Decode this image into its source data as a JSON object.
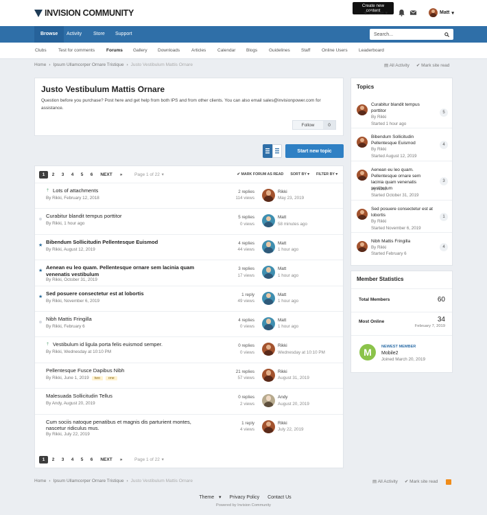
{
  "header": {
    "logo": "INVISION COMMUNITY",
    "tooltip": "Create new content",
    "create_label": "Create",
    "user_name": "Matt"
  },
  "nav": {
    "items": [
      "Browse",
      "Activity",
      "Store",
      "Support"
    ],
    "active": "Browse",
    "search_placeholder": "Search..."
  },
  "subnav": {
    "items": [
      "Clubs",
      "Test for comments",
      "Forums",
      "Gallery",
      "Downloads",
      "Articles",
      "Calendar",
      "Blogs",
      "Guidelines",
      "Staff",
      "Online Users",
      "Leaderboard"
    ],
    "active": "Forums"
  },
  "breadcrumb": {
    "items": [
      "Home",
      "Ipsum Ullamcorper Ornare Tristique",
      "Justo Vestibulum Mattis Ornare"
    ],
    "all_activity": "All Activity",
    "mark_read": "Mark site read"
  },
  "forum": {
    "title": "Justo Vestibulum Mattis Ornare",
    "description": "Question before you purchase? Post here and get help from both IPS and from other clients. You can also email sales@invisionpower.com for assistance.",
    "follow_label": "Follow",
    "follow_count": "0",
    "start_topic": "Start new topic"
  },
  "pagination": {
    "pages": [
      "1",
      "2",
      "3",
      "4",
      "5",
      "6"
    ],
    "current": "1",
    "next": "NEXT",
    "last": "»",
    "page_of": "Page 1 of 22"
  },
  "list_tools": {
    "mark_read": "MARK FORUM AS READ",
    "sort_by": "SORT BY",
    "filter_by": "FILTER BY"
  },
  "topics": [
    {
      "title": "Lots of attachments",
      "meta": "By Rikki, February 12, 2018",
      "replies": "2 replies",
      "views": "114 views",
      "last_user": "Rikki",
      "last_time": "May 23, 2019",
      "avatar": "rikki",
      "marker": "⇡",
      "bold": false,
      "tags": []
    },
    {
      "title": "Curabitur blandit tempus porttitor",
      "meta": "By Rikki, 1 hour ago",
      "replies": "5 replies",
      "views": "0 views",
      "last_user": "Matt",
      "last_time": "58 minutes ago",
      "avatar": "matt",
      "marker": "dot",
      "bold": false,
      "tags": []
    },
    {
      "title": "Bibendum Sollicitudin Pellentesque Euismod",
      "meta": "By Rikki, August 12, 2019",
      "replies": "4 replies",
      "views": "44 views",
      "last_user": "Matt",
      "last_time": "1 hour ago",
      "avatar": "matt",
      "marker": "★",
      "bold": true,
      "tags": []
    },
    {
      "title": "Aenean eu leo quam. Pellentesque ornare sem lacinia quam venenatis vestibulum",
      "meta": "By Rikki, October 31, 2019",
      "replies": "3 replies",
      "views": "17 views",
      "last_user": "Matt",
      "last_time": "1 hour ago",
      "avatar": "matt",
      "marker": "★",
      "bold": true,
      "tags": []
    },
    {
      "title": "Sed posuere consectetur est at lobortis",
      "meta": "By Rikki, November 6, 2019",
      "replies": "1 reply",
      "views": "49 views",
      "last_user": "Matt",
      "last_time": "1 hour ago",
      "avatar": "matt",
      "marker": "★",
      "bold": true,
      "tags": []
    },
    {
      "title": "Nibh Mattis Fringilla",
      "meta": "By Rikki, February 6",
      "replies": "4 replies",
      "views": "0 views",
      "last_user": "Matt",
      "last_time": "1 hour ago",
      "avatar": "matt",
      "marker": "dot",
      "bold": false,
      "tags": []
    },
    {
      "title": "Vestibulum id ligula porta felis euismod semper.",
      "meta": "By Rikki, Wednesday at 10:10 PM",
      "replies": "0 replies",
      "views": "0 views",
      "last_user": "Rikki",
      "last_time": "Wednesday at 10:10 PM",
      "avatar": "rikki",
      "marker": "⇡",
      "bold": false,
      "tags": []
    },
    {
      "title": "Pellentesque Fusce Dapibus Nibh",
      "meta": "By Rikki, June 1, 2019",
      "replies": "21 replies",
      "views": "57 views",
      "last_user": "Rikki",
      "last_time": "August 31, 2019",
      "avatar": "rikki",
      "marker": "",
      "bold": false,
      "tags": [
        "two",
        "one"
      ]
    },
    {
      "title": "Malesuada Sollicitudin Tellus",
      "meta": "By Andy, August 20, 2019",
      "replies": "0 replies",
      "views": "2 views",
      "last_user": "Andy",
      "last_time": "August 20, 2019",
      "avatar": "andy",
      "marker": "",
      "bold": false,
      "tags": []
    },
    {
      "title": "Cum sociis natoque penatibus et magnis dis parturient montes, nascetur ridiculus mus.",
      "meta": "By Rikki, July 22, 2019",
      "replies": "1 reply",
      "views": "4 views",
      "last_user": "Rikki",
      "last_time": "July 22, 2019",
      "avatar": "rikki",
      "marker": "",
      "bold": false,
      "tags": []
    }
  ],
  "sidebar_topics": {
    "title": "Topics",
    "items": [
      {
        "title": "Curabitur blandit tempus porttitor",
        "by": "By Rikki",
        "started": "Started 1 hour ago",
        "count": "5"
      },
      {
        "title": "Bibendum Sollicitudin Pellentesque Euismod",
        "by": "By Rikki",
        "started": "Started August 12, 2019",
        "count": "4"
      },
      {
        "title": "Aenean eu leo quam. Pellentesque ornare sem lacinia quam venenatis vestibulum",
        "by": "By Rikki",
        "started": "Started October 31, 2019",
        "count": "3"
      },
      {
        "title": "Sed posuere consectetur est at lobortis",
        "by": "By Rikki",
        "started": "Started November 6, 2019",
        "count": "1"
      },
      {
        "title": "Nibh Mattis Fringilla",
        "by": "By Rikki",
        "started": "Started February 6",
        "count": "4"
      }
    ]
  },
  "member_stats": {
    "title": "Member Statistics",
    "total_label": "Total Members",
    "total_value": "60",
    "online_label": "Most Online",
    "online_value": "34",
    "online_date": "February 7, 2019",
    "newest_label": "NEWEST MEMBER",
    "newest_name": "Mobile2",
    "newest_joined": "Joined March 20, 2019",
    "newest_initial": "M"
  },
  "footer": {
    "theme": "Theme",
    "privacy": "Privacy Policy",
    "contact": "Contact Us",
    "powered": "Powered by Invision Community"
  },
  "colors": {
    "brand": "#2f6fa8",
    "button": "#2f80c4",
    "star": "#2a6b9a"
  }
}
